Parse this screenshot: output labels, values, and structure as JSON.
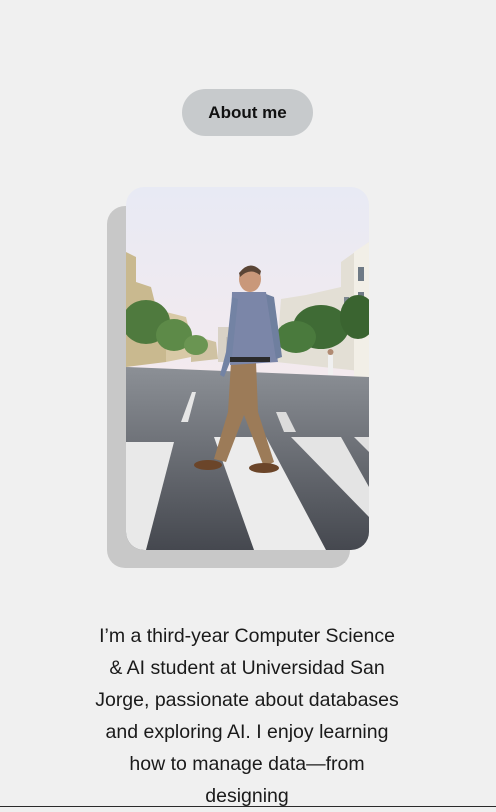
{
  "section": {
    "heading_button": "About me"
  },
  "photo": {
    "icon": "portrait-photo",
    "alt": "Man walking across a crosswalk on a city street"
  },
  "bio": {
    "text": "I’m a third-year Computer Science & AI student at Universidad San Jorge, passionate about databases and exploring AI. I enjoy learning how to manage data—from designing"
  },
  "colors": {
    "background": "#f0f0f0",
    "pill": "#c7cacc",
    "shadow_card": "#c8c8c8"
  }
}
